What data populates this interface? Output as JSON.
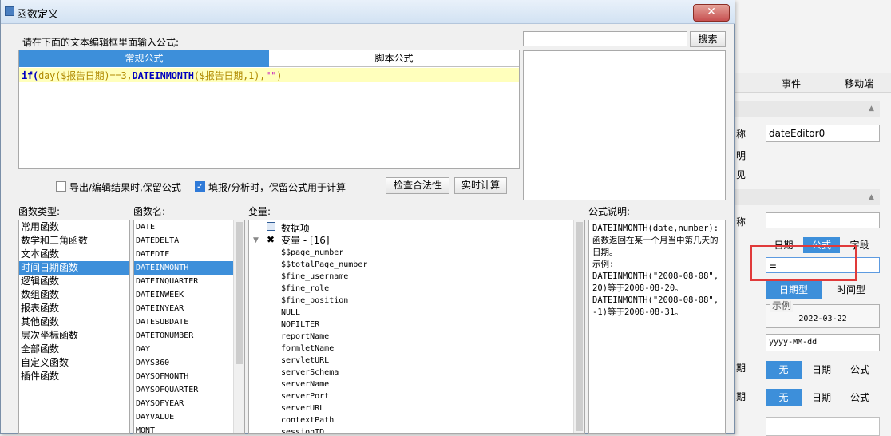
{
  "dialog": {
    "title": "函数定义",
    "close_label": "✕",
    "prompt": "请在下面的文本编辑框里面输入公式:",
    "search_button": "搜索",
    "search_value": "",
    "tabs": {
      "normal": "常规公式",
      "script": "脚本公式"
    },
    "formula": {
      "p1": "if(",
      "p2": "day",
      "p3": "(",
      "p4": "$报告日期",
      "p5": ")==3,",
      "p6": "DATEINMONTH",
      "p7": "(",
      "p8": "$报告日期",
      "p9": ",1),",
      "p10": "\"\"",
      "p11": ")"
    },
    "options": {
      "keep_on_export": "导出/编辑结果时,保留公式",
      "keep_on_export_checked": false,
      "keep_on_fill": "填报/分析时，保留公式用于计算",
      "keep_on_fill_checked": true,
      "check_button": "检查合法性",
      "realtime_button": "实时计算"
    },
    "sections": {
      "types": "函数类型:",
      "names": "函数名:",
      "vars": "变量:",
      "desc": "公式说明:"
    },
    "function_types": [
      "常用函数",
      "数学和三角函数",
      "文本函数",
      "时间日期函数",
      "逻辑函数",
      "数组函数",
      "报表函数",
      "其他函数",
      "层次坐标函数",
      "全部函数",
      "自定义函数",
      "插件函数"
    ],
    "selected_type_index": 3,
    "function_names": [
      "DATE",
      "DATEDELTA",
      "DATEDIF",
      "DATEINMONTH",
      "DATEINQUARTER",
      "DATEINWEEK",
      "DATEINYEAR",
      "DATESUBDATE",
      "DATETONUMBER",
      "DAY",
      "DAYS360",
      "DAYSOFMONTH",
      "DAYSOFQUARTER",
      "DAYSOFYEAR",
      "DAYVALUE",
      "MONT"
    ],
    "selected_name_index": 3,
    "variables": {
      "data_item": "数据项",
      "var_group": "变量 - [16]",
      "items": [
        "$$page_number",
        "$$totalPage_number",
        "$fine_username",
        "$fine_role",
        "$fine_position",
        "NULL",
        "NOFILTER",
        "reportName",
        "formletName",
        "servletURL",
        "serverSchema",
        "serverName",
        "serverPort",
        "serverURL",
        "contextPath",
        "sessionID"
      ]
    },
    "description": "DATEINMONTH(date,number):函数返回在某一个月当中第几天的日期。\n示例:\nDATEINMONTH(\"2008-08-08\",20)等于2008-08-20。\nDATEINMONTH(\"2008-08-08\",-1)等于2008-08-31。"
  },
  "panel": {
    "tabs": [
      "事件",
      "移动端"
    ],
    "label_name": "称",
    "label_b": "明",
    "label_c": "见",
    "name_value": "dateEditor0",
    "label_name2": "称",
    "name2_value": "",
    "seg1": [
      "日期",
      "公式",
      "字段"
    ],
    "seg1_selected": 1,
    "formula_value": "=",
    "seg2": [
      "日期型",
      "时间型"
    ],
    "seg2_selected": 0,
    "example_label": "示例",
    "example_value": "2022-03-22",
    "format_value": "yyyy-MM-dd",
    "label_d": "期",
    "seg3": [
      "无",
      "日期",
      "公式"
    ],
    "label_e": "期",
    "seg4": [
      "无",
      "日期",
      "公式"
    ]
  }
}
